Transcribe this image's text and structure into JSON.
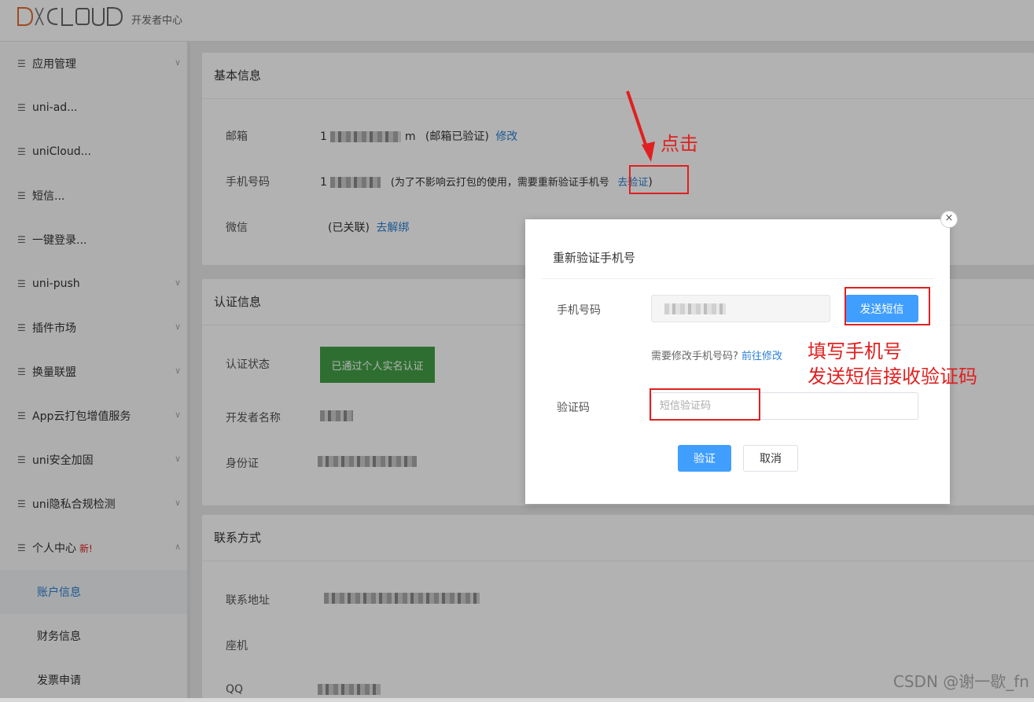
{
  "header": {
    "logo_text": "DCLOUD",
    "subtitle": "开发者中心"
  },
  "sidebar": {
    "items": [
      {
        "label": "应用管理",
        "chevron": "down"
      },
      {
        "label": "uni-ad...",
        "chevron": ""
      },
      {
        "label": "uniCloud...",
        "chevron": ""
      },
      {
        "label": "短信...",
        "chevron": ""
      },
      {
        "label": "一键登录...",
        "chevron": ""
      },
      {
        "label": "uni-push",
        "chevron": "down"
      },
      {
        "label": "插件市场",
        "chevron": "down"
      },
      {
        "label": "换量联盟",
        "chevron": "down"
      },
      {
        "label": "App云打包增值服务",
        "chevron": "down"
      },
      {
        "label": "uni安全加固",
        "chevron": "down"
      },
      {
        "label": "uni隐私合规检测",
        "chevron": "down"
      },
      {
        "label": "个人中心",
        "badge": "新!",
        "chevron": "up"
      }
    ],
    "sub_items": [
      {
        "label": "账户信息",
        "active": true
      },
      {
        "label": "财务信息",
        "active": false
      },
      {
        "label": "发票申请",
        "active": false
      }
    ]
  },
  "basic": {
    "title": "基本信息",
    "email_label": "邮箱",
    "email_prefix": "1",
    "email_suffix": "m",
    "email_status": "(邮箱已验证)",
    "email_link": "修改",
    "phone_label": "手机号码",
    "phone_prefix": "1",
    "phone_note": "(为了不影响云打包的使用，需要重新验证手机号",
    "phone_link": "去验证",
    "phone_close": ")",
    "wechat_label": "微信",
    "wechat_status": "(已关联)",
    "wechat_link": "去解绑"
  },
  "auth": {
    "title": "认证信息",
    "status_label": "认证状态",
    "status_value": "已通过个人实名认证",
    "dev_name_label": "开发者名称",
    "id_label": "身份证"
  },
  "contact": {
    "title": "联系方式",
    "address_label": "联系地址",
    "landline_label": "座机",
    "qq_label": "QQ"
  },
  "modal": {
    "title": "重新验证手机号",
    "close": "×",
    "phone_label": "手机号码",
    "send_sms": "发送短信",
    "hint": "需要修改手机号码?",
    "hint_link": "前往修改",
    "code_label": "验证码",
    "code_placeholder": "短信验证码",
    "confirm": "验证",
    "cancel": "取消"
  },
  "annotations": {
    "click": "点击",
    "fill_line1": "填写手机号",
    "fill_line2": "发送短信接收验证码"
  },
  "watermark": "CSDN @谢一歇_fn",
  "colors": {
    "accent": "#409eff",
    "annotation": "#e02020",
    "verified": "#43a047",
    "logo_d": "#e36b2d"
  }
}
